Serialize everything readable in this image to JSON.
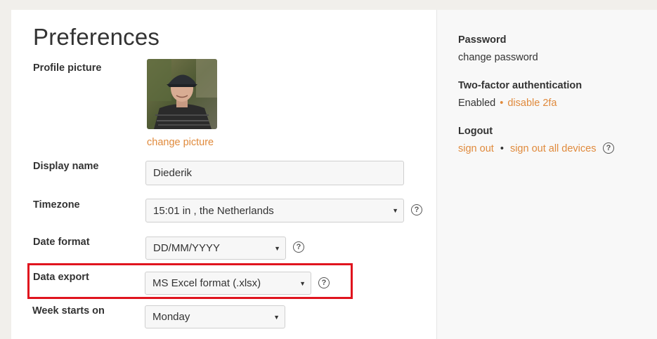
{
  "main": {
    "title": "Preferences",
    "profile_picture": {
      "label": "Profile picture",
      "change_link": "change picture"
    },
    "display_name": {
      "label": "Display name",
      "value": "Diederik"
    },
    "timezone": {
      "label": "Timezone",
      "value": "15:01 in , the Netherlands"
    },
    "date_format": {
      "label": "Date format",
      "value": "DD/MM/YYYY"
    },
    "data_export": {
      "label": "Data export",
      "value": "MS Excel format (.xlsx)"
    },
    "week_starts": {
      "label": "Week starts on",
      "value": "Monday"
    },
    "help_glyph": "?",
    "select_arrow": "▼"
  },
  "sidebar": {
    "password": {
      "heading": "Password",
      "link": "change password"
    },
    "two_factor": {
      "heading": "Two-factor authentication",
      "status": "Enabled",
      "separator": "•",
      "link": "disable 2fa"
    },
    "logout": {
      "heading": "Logout",
      "sign_out": "sign out",
      "separator": "•",
      "sign_out_all": "sign out all devices"
    }
  },
  "colors": {
    "accent": "#e08a3c",
    "highlight": "#e0141e"
  },
  "icons": {
    "help": "help-circle-icon",
    "dropdown": "chevron-down-icon"
  }
}
